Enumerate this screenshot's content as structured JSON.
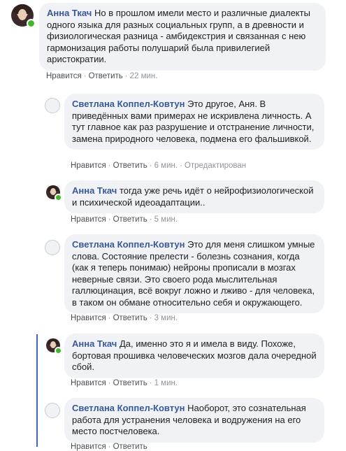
{
  "comments": [
    {
      "author": "Анна Ткач",
      "text": "Но в прошлом имели место и различные диалекты одного языка для разных социальных групп, а в древности и физиологическая разница - амбидекстрия и связанная с нею гармонизация работы полушарий была привилегией аристократии.",
      "like": "Нравится",
      "reply": "Ответить",
      "time": "22 мин.",
      "edited": ""
    },
    {
      "author": "Светлана Коппел-Ковтун",
      "text": "Это другое, Аня. В приведённых вами примерах не искривлена личность. А тут главное как раз разрушение и отстранение личности, замена природного человека, подмена его фальшивкой.",
      "like": "Нравится",
      "reply": "Ответить",
      "time": "6 мин.",
      "edited": "Отредактирован"
    },
    {
      "author": "Анна Ткач",
      "text": "тогда уже речь идёт о нейрофизиологической и психической идеоадаптации..",
      "like": "Нравится",
      "reply": "Ответить",
      "time": "5 мин.",
      "edited": ""
    },
    {
      "author": "Светлана Коппел-Ковтун",
      "text": "Это для меня слишком умные слова. Состояние прелести - болезнь сознания, когда (как я теперь понимаю) нейроны прописали в мозгах неверные связи. Это своего рода мыслительная галлюцинация, всё вокруг ложно и лживо - для человека, в таком он обмане относительно себя и окружающего.",
      "like": "Нравится",
      "reply": "Ответить",
      "time": "3 мин.",
      "edited": ""
    },
    {
      "author": "Анна Ткач",
      "text": "Да, именно это я и имела в виду. Похоже, бортовая прошивка человеческих мозгов дала очередной сбой.",
      "like": "Нравится",
      "reply": "Ответить",
      "time": "1 мин.",
      "edited": ""
    },
    {
      "author": "Светлана Коппел-Ковтун",
      "text": "Наоборот, это сознательная работа для устранения человека и водружения на его место постчеловека.",
      "like": "Нравится",
      "reply": "Ответить",
      "time": "",
      "edited": ""
    }
  ]
}
